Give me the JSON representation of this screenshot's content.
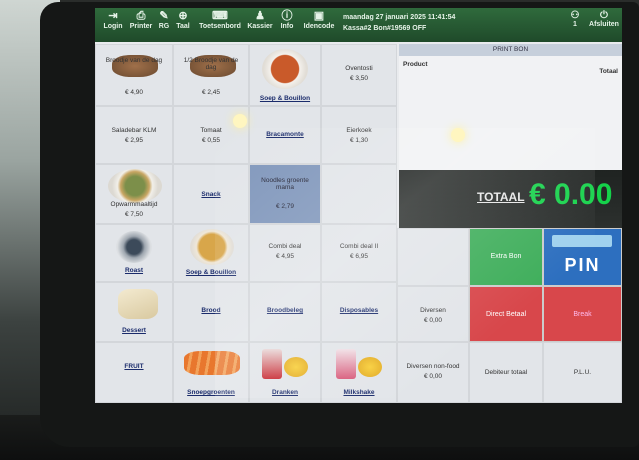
{
  "toolbar": {
    "buttons": [
      {
        "label": "Login",
        "icon": "login-icon",
        "glyph": "⇥"
      },
      {
        "label": "Printer",
        "icon": "printer-icon",
        "glyph": "⎙"
      },
      {
        "label": "RG",
        "icon": "wrench-icon",
        "glyph": "✎"
      },
      {
        "label": "Taal",
        "icon": "globe-icon",
        "glyph": "⊕"
      },
      {
        "label": "Toetsenbord",
        "icon": "keyboard-icon",
        "glyph": "⌨"
      },
      {
        "label": "Kassier",
        "icon": "user-icon",
        "glyph": "♟"
      },
      {
        "label": "Info",
        "icon": "info-icon",
        "glyph": "ⓘ"
      },
      {
        "label": "Idencode",
        "icon": "id-card-icon",
        "glyph": "▣"
      }
    ],
    "datetime": "maandag 27 januari 2025 11:41:54",
    "status": "Kassa#2 Bon#19569 OFF",
    "user_count": "1",
    "logout_label": "Afsluiten"
  },
  "products": [
    {
      "name": "Broodje van de dag",
      "price": "€ 4,90"
    },
    {
      "name": "1/2 Broodje van de dag",
      "price": "€ 2,45"
    },
    {
      "name": "Soep & Bouillon",
      "price": ""
    },
    {
      "name": "Oventosti",
      "price": "€ 3,50"
    },
    {
      "name": "Saladebar KLM",
      "price": "€ 2,95"
    },
    {
      "name": "Tomaat",
      "price": "€ 0,55"
    },
    {
      "name": "Bracamonte",
      "price": ""
    },
    {
      "name": "Eierkoek",
      "price": "€ 1,30"
    },
    {
      "name": "Opwarmmaaltijd",
      "price": "€ 7,50"
    },
    {
      "name": "Snack",
      "price": ""
    },
    {
      "name": "Noodles groente mama",
      "price": "€ 2,79"
    },
    {
      "name": "",
      "price": ""
    },
    {
      "name": "Roast",
      "price": ""
    },
    {
      "name": "Soep & Bouillon",
      "price": ""
    },
    {
      "name": "Combi deal",
      "price": "€ 4,95"
    },
    {
      "name": "Combi deal II",
      "price": "€ 6,95"
    },
    {
      "name": "Dessert",
      "price": ""
    },
    {
      "name": "Brood",
      "price": ""
    },
    {
      "name": "Broodbeleg",
      "price": ""
    },
    {
      "name": "Disposables",
      "price": ""
    },
    {
      "name": "FRUIT",
      "price": ""
    },
    {
      "name": "Snoepgroenten",
      "price": ""
    },
    {
      "name": "Dranken",
      "price": ""
    },
    {
      "name": "Milkshake",
      "price": ""
    }
  ],
  "diversen": {
    "label": "Diversen",
    "price": "€ 0,00"
  },
  "diversen_nonfood": {
    "label": "Diversen non-food",
    "price": "€ 0,00"
  },
  "receipt": {
    "print_label": "PRINT BON",
    "col_product": "Product",
    "col_total": "Totaal"
  },
  "total": {
    "label": "TOTAAL",
    "value": "€ 0.00"
  },
  "actions": {
    "extra_bon": "Extra Bon",
    "pin": "PIN",
    "direct_betalen": "Direct Betaal",
    "break": "Break",
    "debiteur": "Debiteur totaal",
    "plu": "P.L.U."
  },
  "colors": {
    "toolbar": "#2f6a3c",
    "total_green": "#15d24a",
    "extra_bon": "#3fae5b",
    "pin": "#2d6fbf",
    "direct": "#d8474b",
    "break": "#d8474b",
    "highlight": "#7f96bb"
  }
}
